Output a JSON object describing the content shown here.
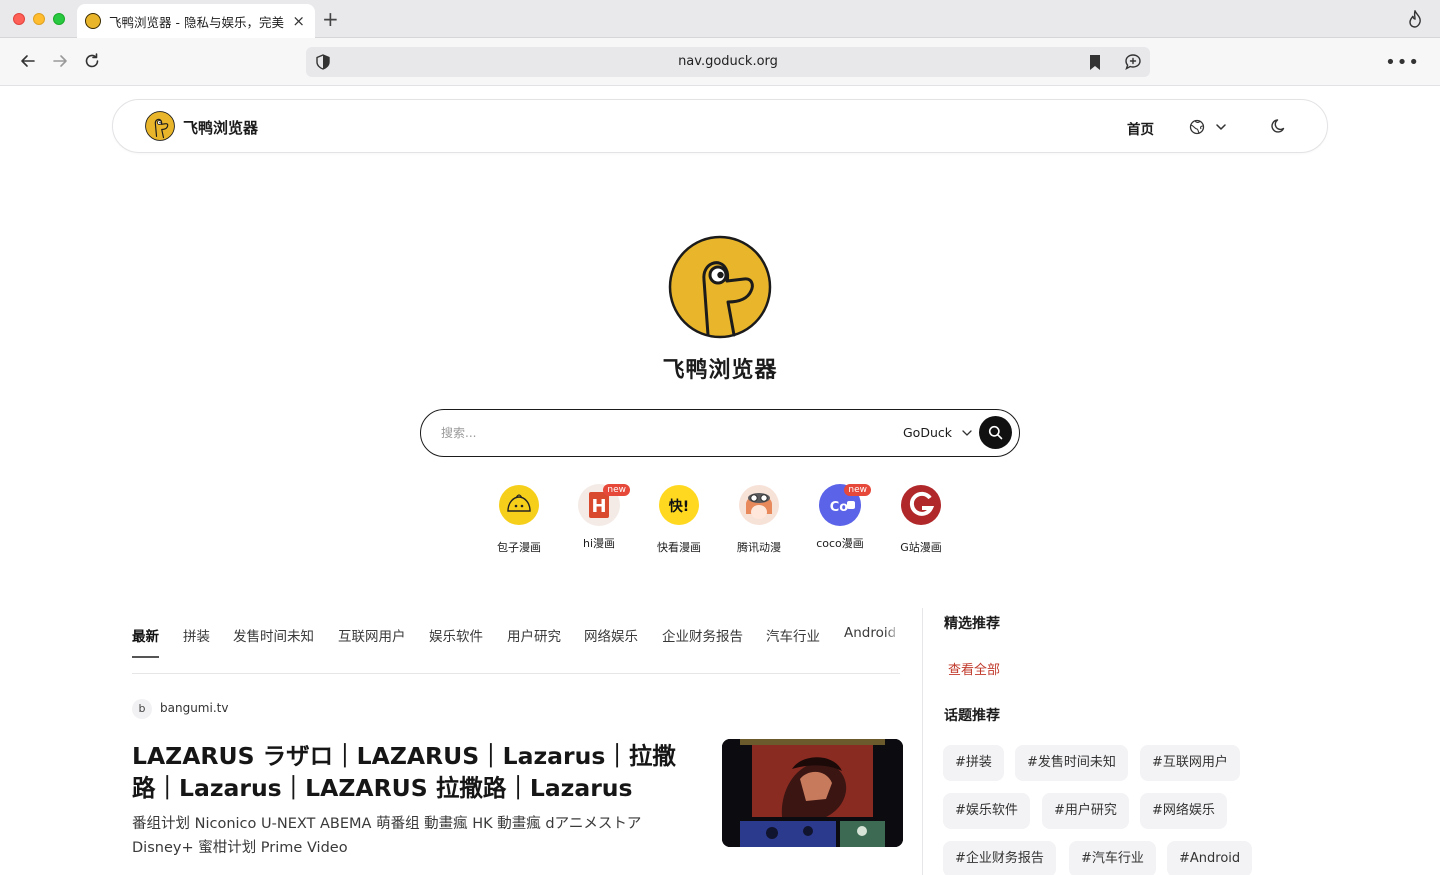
{
  "browser": {
    "tab_title": "飞鸭浏览器 - 隐私与娱乐，完美",
    "url": "nav.goduck.org"
  },
  "header": {
    "site_name": "飞鸭浏览器",
    "nav_home": "首页"
  },
  "hero": {
    "title": "飞鸭浏览器"
  },
  "search": {
    "placeholder": "搜索...",
    "engine": "GoDuck"
  },
  "quick_links": [
    {
      "label": "包子漫画",
      "badge": ""
    },
    {
      "label": "hi漫画",
      "badge": "new"
    },
    {
      "label": "快看漫画",
      "badge": ""
    },
    {
      "label": "腾讯动漫",
      "badge": ""
    },
    {
      "label": "coco漫画",
      "badge": "new"
    },
    {
      "label": "G站漫画",
      "badge": ""
    }
  ],
  "category_tabs": [
    "最新",
    "拼装",
    "发售时间未知",
    "互联网用户",
    "娱乐软件",
    "用户研究",
    "网络娱乐",
    "企业财务报告",
    "汽车行业",
    "Android"
  ],
  "article": {
    "source_initial": "b",
    "source": "bangumi.tv",
    "title": "LAZARUS ラザロ｜LAZARUS｜Lazarus｜拉撒路｜Lazarus｜LAZARUS 拉撒路｜Lazarus",
    "description": "番组计划 Niconico U-NEXT ABEMA 萌番组 動畫瘋 HK 動畫瘋 dアニメストア Disney+ 蜜柑计划 Prime Video"
  },
  "sidebar": {
    "featured_heading": "精选推荐",
    "view_all": "查看全部",
    "topics_heading": "话题推荐",
    "topics": [
      "#拼装",
      "#发售时间未知",
      "#互联网用户",
      "#娱乐软件",
      "#用户研究",
      "#网络娱乐",
      "#企业财务报告",
      "#汽车行业",
      "#Android"
    ]
  },
  "colors": {
    "brand_yellow": "#e9b52a",
    "accent_red": "#c0392b",
    "badge_red": "#e6483a"
  }
}
